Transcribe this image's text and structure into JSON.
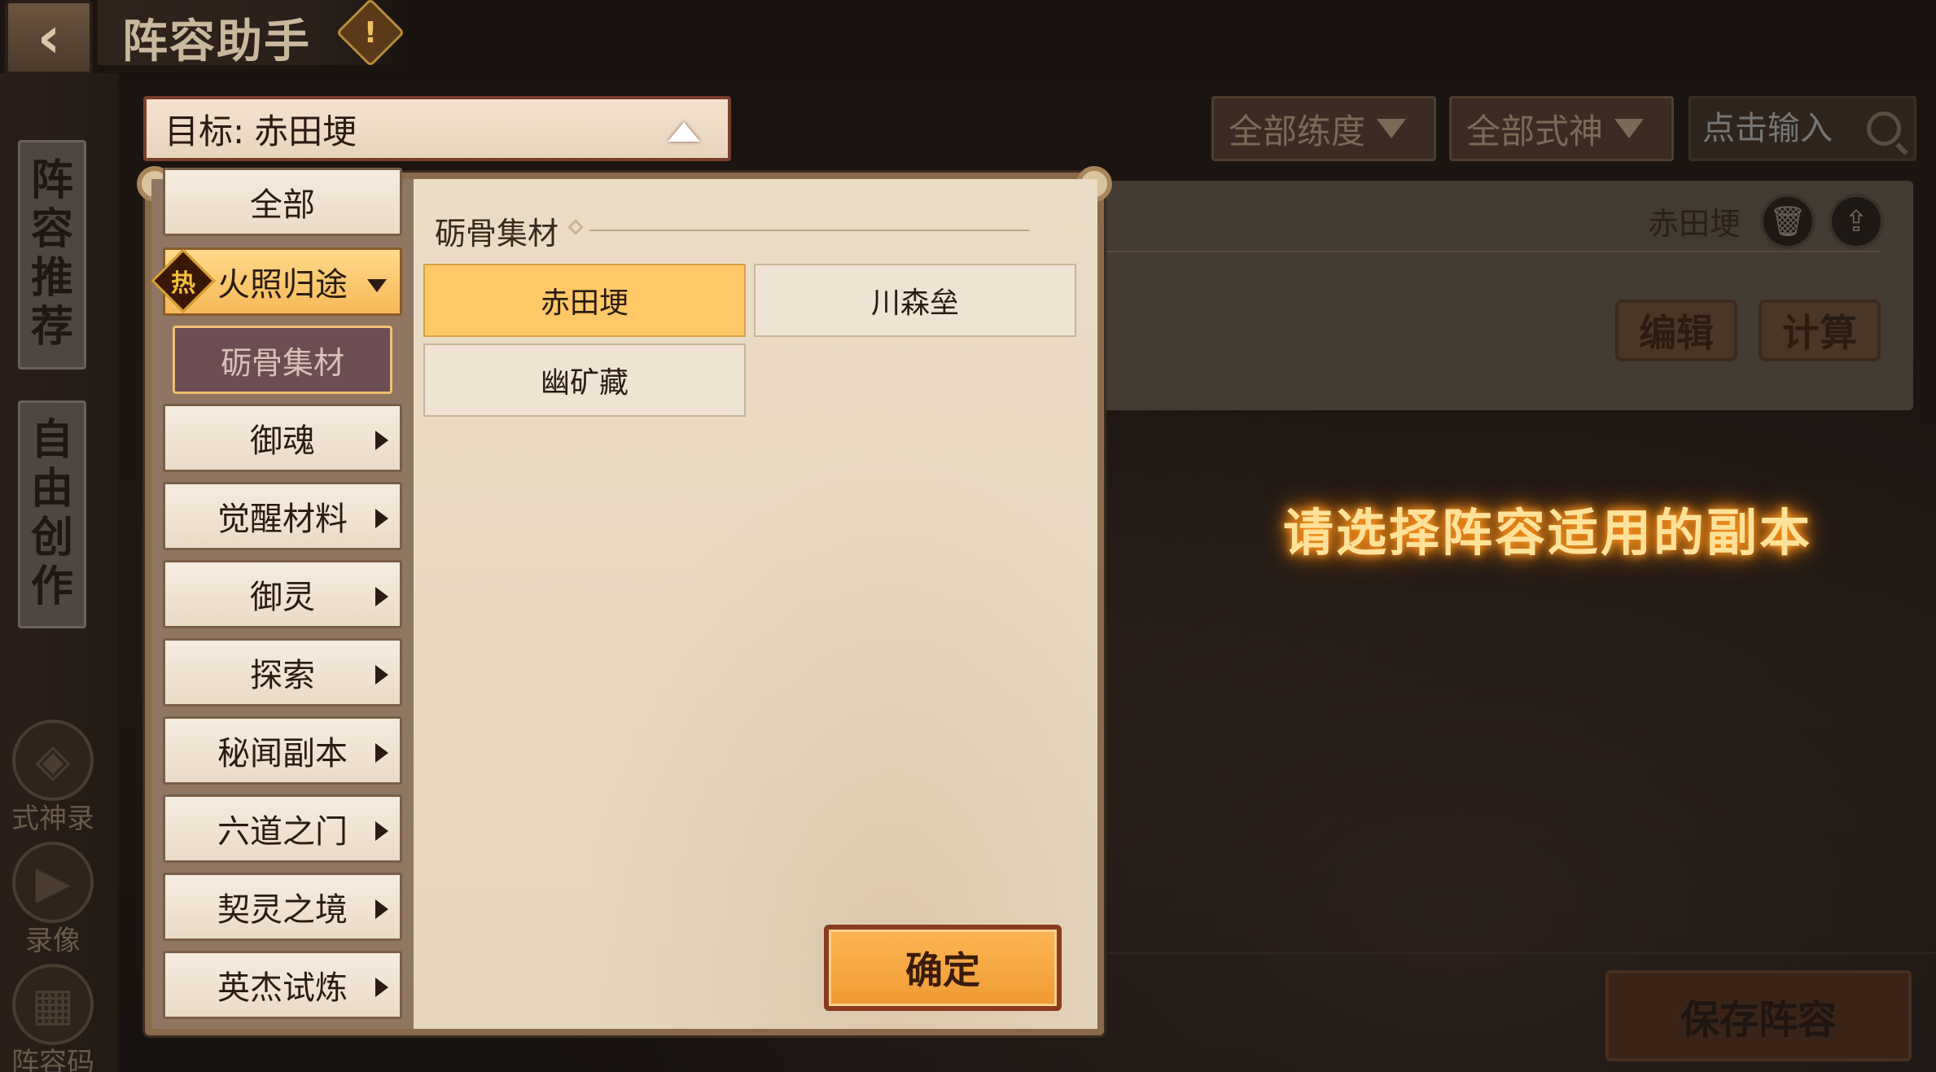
{
  "header": {
    "title": "阵容助手",
    "warning_glyph": "!"
  },
  "left_rail": {
    "tab_recommend": [
      "阵",
      "容",
      "推",
      "荐"
    ],
    "tab_free_create": [
      "自",
      "由",
      "创",
      "作"
    ],
    "nav": [
      {
        "label": "式神录",
        "icon": "fox-mask-icon"
      },
      {
        "label": "录像",
        "icon": "play-icon"
      },
      {
        "label": "阵容码",
        "icon": "grid-code-icon"
      }
    ]
  },
  "filters": {
    "training": "全部练度",
    "shikigami": "全部式神",
    "search_placeholder": "点击输入"
  },
  "lineup_card": {
    "name": "赤田埂",
    "edit_label": "编辑",
    "calc_label": "计算"
  },
  "hint": "请选择阵容适用的副本",
  "save_label": "保存阵容",
  "target": {
    "prefix": "目标:",
    "value": "赤田埂"
  },
  "menu": {
    "all": "全部",
    "active_group": "火照归途",
    "hot_badge": "热",
    "sub_selected": "砺骨集材",
    "items": [
      "御魂",
      "觉醒材料",
      "御灵",
      "探索",
      "秘闻副本",
      "六道之门",
      "契灵之境",
      "英杰试炼"
    ]
  },
  "content": {
    "section_title": "砺骨集材",
    "options": [
      {
        "label": "赤田埂",
        "selected": true
      },
      {
        "label": "川森垒",
        "selected": false
      },
      {
        "label": "幽矿藏",
        "selected": false
      }
    ],
    "confirm_label": "确定"
  },
  "colors": {
    "accent_orange": "#f6b957",
    "hint_glow": "#ffe29a",
    "panel_bg": "#e5d5bf"
  }
}
